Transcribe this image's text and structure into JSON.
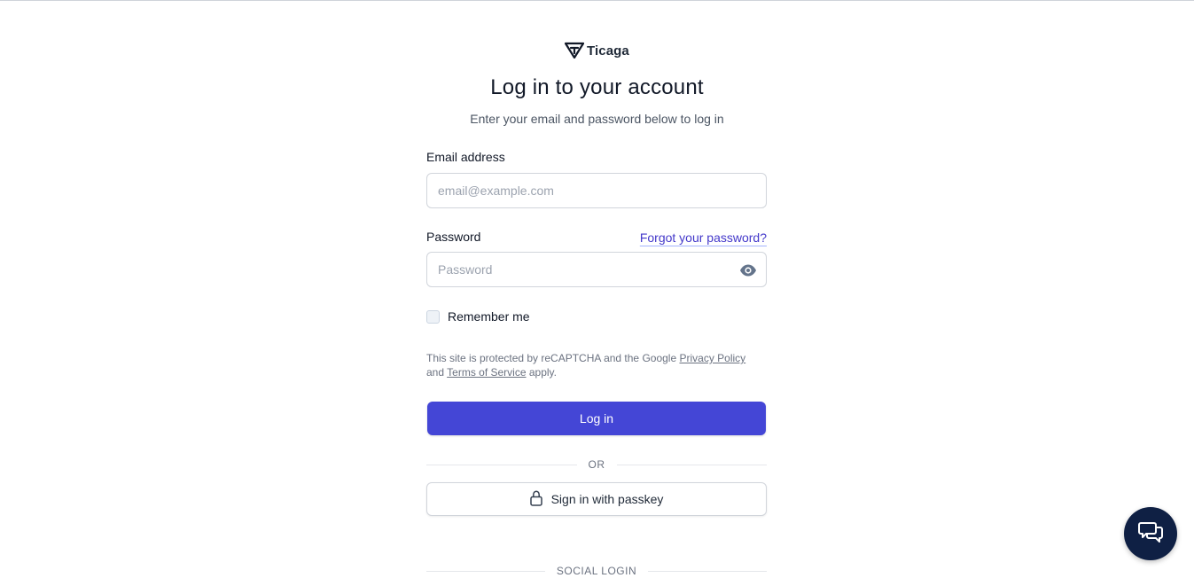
{
  "brand": {
    "name": "Ticaga",
    "icon": "ticaga-logo-icon"
  },
  "header": {
    "title": "Log in to your account",
    "subtitle": "Enter your email and password below to log in"
  },
  "form": {
    "email": {
      "label": "Email address",
      "value": "",
      "placeholder": "email@example.com"
    },
    "password": {
      "label": "Password",
      "value": "",
      "placeholder": "Password",
      "toggle_icon": "eye-icon"
    },
    "forgot_link": "Forgot your password?",
    "remember": {
      "label": "Remember me",
      "checked": false
    },
    "legal": {
      "prefix": "This site is protected by reCAPTCHA and the Google",
      "privacy_link": "Privacy Policy",
      "middle": "and",
      "terms_link": "Terms of Service",
      "suffix": "apply."
    },
    "submit_label": "Log in",
    "or_divider": "OR",
    "passkey_label": "Sign in with passkey",
    "passkey_icon": "lock-icon",
    "social_divider": "SOCIAL LOGIN"
  },
  "chat": {
    "icon": "chat-bubbles-icon"
  },
  "colors": {
    "primary": "#4446d6",
    "link": "#4338ca",
    "chat_fab": "#0f2044"
  }
}
